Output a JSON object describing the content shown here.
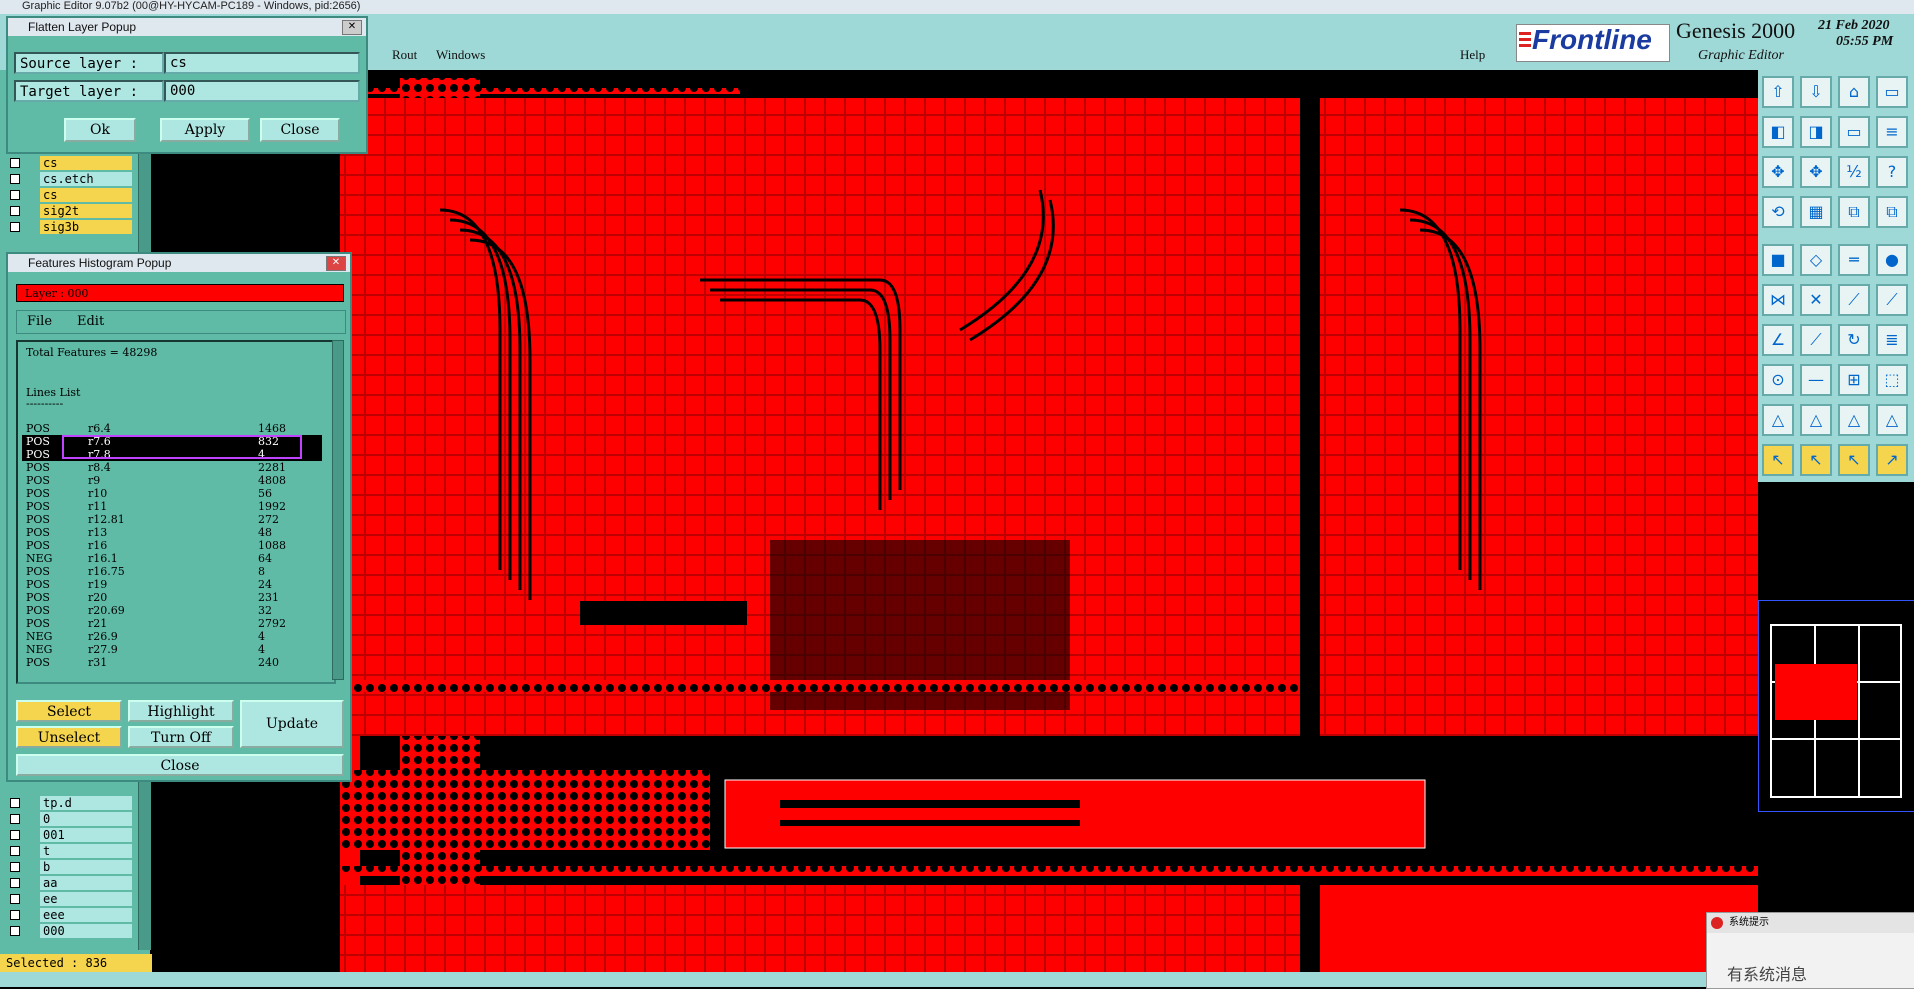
{
  "window": {
    "title": "Graphic Editor 9.07b2 (00@HY-HYCAM-PC189 - Windows, pid:2656)"
  },
  "menubar": {
    "items": [
      "Rout",
      "Windows"
    ],
    "help": "Help"
  },
  "brand": {
    "logo": "Frontline",
    "product": "Genesis 2000",
    "subtitle": "Graphic Editor",
    "date": "21 Feb 2020",
    "time": "05:55 PM"
  },
  "flatten_popup": {
    "title": "Flatten Layer Popup",
    "source_label": "Source layer :",
    "source_value": "cs",
    "target_label": "Target layer :",
    "target_value": "000",
    "ok": "Ok",
    "apply": "Apply",
    "close": "Close"
  },
  "layers_top": [
    {
      "name": "cs",
      "color": "lyr-y"
    },
    {
      "name": "cs.etch",
      "color": "lyr-t"
    },
    {
      "name": "cs",
      "color": "lyr-y"
    },
    {
      "name": "sig2t",
      "color": "lyr-y"
    },
    {
      "name": "sig3b",
      "color": "lyr-y"
    }
  ],
  "layers_bottom": [
    {
      "name": "tp.d",
      "color": "lyr-t"
    },
    {
      "name": "0",
      "color": "lyr-t"
    },
    {
      "name": "001",
      "color": "lyr-t"
    },
    {
      "name": "t",
      "color": "lyr-t"
    },
    {
      "name": "b",
      "color": "lyr-t"
    },
    {
      "name": "aa",
      "color": "lyr-t"
    },
    {
      "name": "ee",
      "color": "lyr-t"
    },
    {
      "name": "eee",
      "color": "lyr-t"
    },
    {
      "name": "000",
      "color": "lyr-t"
    }
  ],
  "status": {
    "selected": "Selected : 836"
  },
  "histogram_popup": {
    "title": "Features Histogram Popup",
    "layer_label": "Layer :  000",
    "menu_file": "File",
    "menu_edit": "Edit",
    "total": "Total Features = 48298",
    "list_title": "Lines List",
    "list_underline": "----------",
    "rows": [
      {
        "pol": "POS",
        "sym": "r6.4",
        "count": "1468"
      },
      {
        "pol": "POS",
        "sym": "r7.6",
        "count": "832"
      },
      {
        "pol": "POS",
        "sym": "r7.8",
        "count": "4"
      },
      {
        "pol": "POS",
        "sym": "r8.4",
        "count": "2281"
      },
      {
        "pol": "POS",
        "sym": "r9",
        "count": "4808"
      },
      {
        "pol": "POS",
        "sym": "r10",
        "count": "56"
      },
      {
        "pol": "POS",
        "sym": "r11",
        "count": "1992"
      },
      {
        "pol": "POS",
        "sym": "r12.81",
        "count": "272"
      },
      {
        "pol": "POS",
        "sym": "r13",
        "count": "48"
      },
      {
        "pol": "POS",
        "sym": "r16",
        "count": "1088"
      },
      {
        "pol": "NEG",
        "sym": "r16.1",
        "count": "64"
      },
      {
        "pol": "POS",
        "sym": "r16.75",
        "count": "8"
      },
      {
        "pol": "POS",
        "sym": "r19",
        "count": "24"
      },
      {
        "pol": "POS",
        "sym": "r20",
        "count": "231"
      },
      {
        "pol": "POS",
        "sym": "r20.69",
        "count": "32"
      },
      {
        "pol": "POS",
        "sym": "r21",
        "count": "2792"
      },
      {
        "pol": "NEG",
        "sym": "r26.9",
        "count": "4"
      },
      {
        "pol": "NEG",
        "sym": "r27.9",
        "count": "4"
      },
      {
        "pol": "POS",
        "sym": "r31",
        "count": "240"
      }
    ],
    "select": "Select",
    "highlight": "Highlight",
    "update": "Update",
    "unselect": "Unselect",
    "turn_off": "Turn Off",
    "close": "Close"
  },
  "toast": {
    "title": "系统提示",
    "message": "有系统消息"
  },
  "colors": {
    "copper": "#ff0000",
    "panel": "#5fbaa6",
    "highlight": "#f5d54e"
  }
}
